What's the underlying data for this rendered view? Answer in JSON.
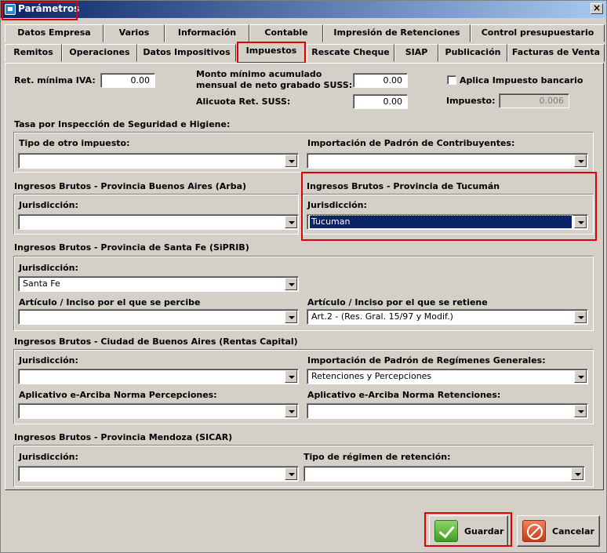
{
  "window": {
    "title": "Parámetros",
    "close_glyph": "×",
    "icon": "app-icon"
  },
  "tabs_row1": [
    "Datos Empresa",
    "Varios",
    "Información",
    "Contable",
    "Impresión de Retenciones",
    "Control presupuestario"
  ],
  "tabs_row2": [
    "Remitos",
    "Operaciones",
    "Datos Impositivos",
    "Impuestos",
    "Rescate Cheque",
    "SIAP",
    "Publicación",
    "Facturas de Venta"
  ],
  "active_tab": "Impuestos",
  "top": {
    "ret_min_iva_label": "Ret. mínima IVA:",
    "ret_min_iva_value": "0.00",
    "monto_minimo_label_1": "Monto mínimo acumulado",
    "monto_minimo_label_2": "mensual de neto grabado SUSS:",
    "monto_minimo_value": "0.00",
    "alicuota_label": "Alicuota Ret. SUSS:",
    "alicuota_value": "0.00",
    "aplica_impuesto_label": "Aplica Impuesto bancario",
    "aplica_impuesto_checked": false,
    "impuesto_label": "Impuesto:",
    "impuesto_value": "0.006"
  },
  "tasa": {
    "title": "Tasa por Inspección de Seguridad e Higiene:",
    "tipo_label": "Tipo de otro impuesto:",
    "tipo_value": "",
    "importacion_label": "Importación de Padrón de Contribuyentes:",
    "importacion_value": ""
  },
  "arba": {
    "title": "Ingresos Brutos - Provincia Buenos Aires (Arba)",
    "jur_label": "Jurisdicción:",
    "jur_value": ""
  },
  "tucuman": {
    "title": "Ingresos Brutos - Provincia de Tucumán",
    "jur_label": "Jurisdicción:",
    "jur_value": "Tucuman"
  },
  "santafe": {
    "title": "Ingresos Brutos - Provincia de Santa Fe (SiPRIB)",
    "jur_label": "Jurisdicción:",
    "jur_value": "Santa Fe",
    "percibe_label": "Artículo / Inciso por el que se percibe",
    "percibe_value": "",
    "retiene_label": "Artículo / Inciso por el que se retiene",
    "retiene_value": "Art.2 - (Res. Gral. 15/97 y Modif.)"
  },
  "caba": {
    "title": "Ingresos Brutos - Ciudad de Buenos Aires (Rentas Capital)",
    "jur_label": "Jurisdicción:",
    "jur_value": "",
    "padron_label": "Importación de Padrón de Regímenes Generales:",
    "padron_value": "Retenciones y Percepciones",
    "perc_label": "Aplicativo e-Arciba Norma Percepciones:",
    "perc_value": "",
    "ret_label": "Aplicativo e-Arciba Norma Retenciones:",
    "ret_value": ""
  },
  "mendoza": {
    "title": "Ingresos Brutos - Provincia Mendoza (SICAR)",
    "jur_label": "Jurisdicción:",
    "jur_value": "",
    "regimen_label": "Tipo de régimen de retención:",
    "regimen_value": ""
  },
  "buttons": {
    "save": "Guardar",
    "cancel": "Cancelar"
  },
  "highlight_color": "#e00000"
}
